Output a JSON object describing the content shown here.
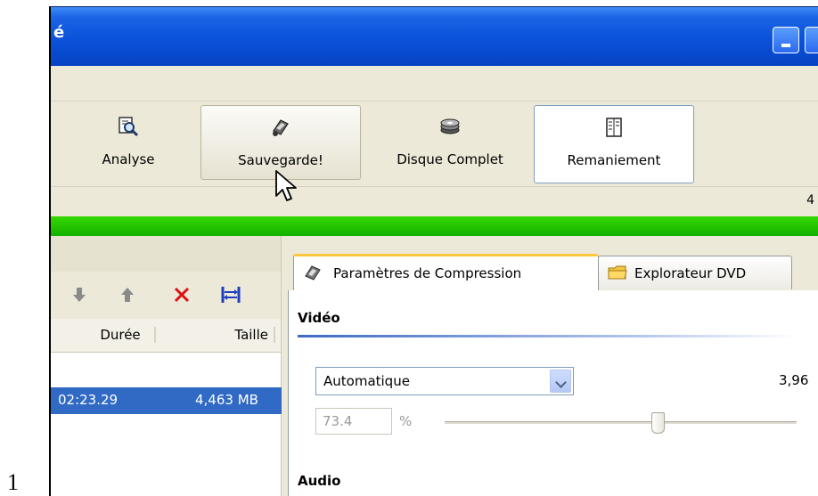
{
  "page_number": "1",
  "window": {
    "title_fragment": "é"
  },
  "toolbar": {
    "analyse_label": "Analyse",
    "save_label": "Sauvegarde!",
    "disk_label": "Disque Complet",
    "remaniement_label": "Remaniement"
  },
  "status": {
    "right_fragment": "4"
  },
  "list": {
    "columns": [
      "Durée",
      "Taille"
    ],
    "rows": [
      {
        "duration": "02:23.29",
        "size": "4,463 MB"
      }
    ]
  },
  "tabs": [
    {
      "label": "Paramètres de Compression",
      "icon": "compression-icon",
      "active": true
    },
    {
      "label": "Explorateur DVD",
      "icon": "folder-icon",
      "active": false
    }
  ],
  "compression": {
    "video_heading": "Vidéo",
    "mode": "Automatique",
    "rate_fragment": "3,96",
    "percent": "73.4",
    "percent_sign": "%",
    "slider_fraction": 0.734,
    "audio_heading": "Audio"
  },
  "colors": {
    "titlebar": "#0a52d9",
    "progress": "#12b000",
    "selection": "#316ac5",
    "tab_accent": "#ffc73c"
  }
}
